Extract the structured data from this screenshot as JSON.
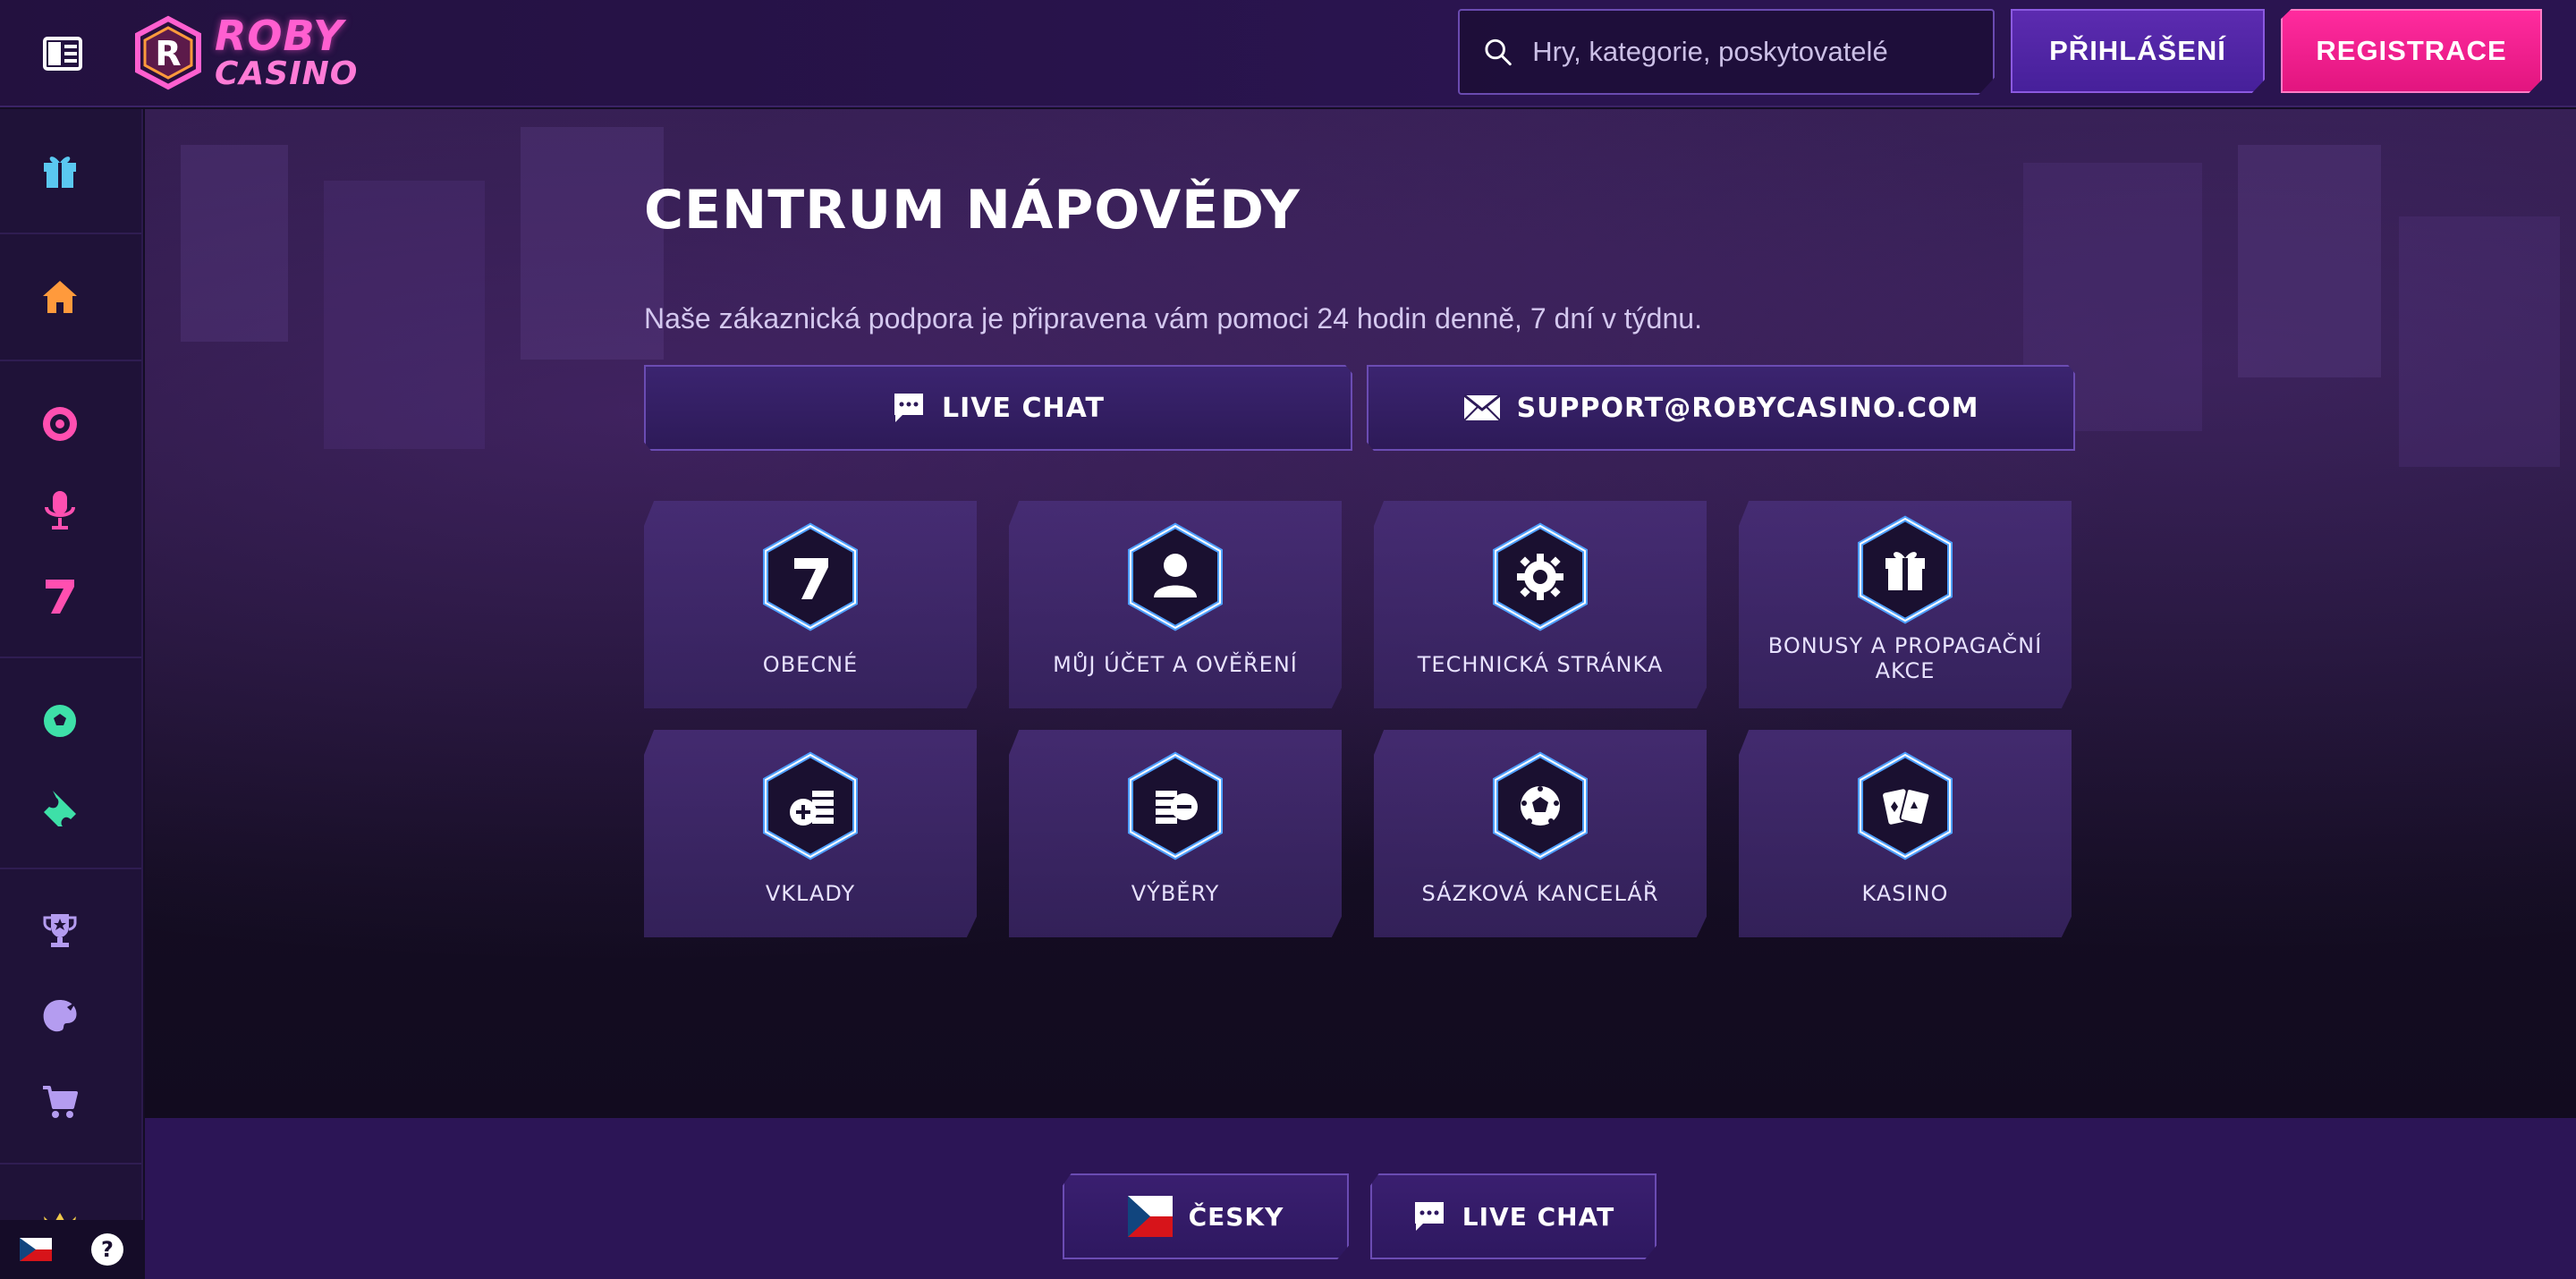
{
  "header": {
    "logo_line1": "ROBY",
    "logo_line2": "CASINO",
    "search_placeholder": "Hry, kategorie, poskytovatelé",
    "login_label": "PŘIHLÁŠENÍ",
    "register_label": "REGISTRACE"
  },
  "sidebar": {
    "items": [
      {
        "name": "gift",
        "color": "#5ac8f0"
      },
      {
        "name": "home",
        "color": "#ff9a3c"
      },
      {
        "name": "live-casino",
        "color": "#ff4fb0"
      },
      {
        "name": "microphone",
        "color": "#ff4fb0"
      },
      {
        "name": "slots-seven",
        "color": "#ff4fb0"
      },
      {
        "name": "sports-ball",
        "color": "#3ee0a8"
      },
      {
        "name": "ticket",
        "color": "#3ee0a8"
      },
      {
        "name": "trophy",
        "color": "#b49cf0"
      },
      {
        "name": "palette",
        "color": "#b49cf0"
      },
      {
        "name": "cart",
        "color": "#b49cf0"
      },
      {
        "name": "crown",
        "color": "#f0c84a"
      }
    ],
    "help_label": "?"
  },
  "main": {
    "title": "CENTRUM NÁPOVĚDY",
    "subtitle": "Naše zákaznická podpora je připravena vám pomoci 24 hodin denně, 7 dní v týdnu.",
    "live_chat_label": "LIVE CHAT",
    "email_label": "SUPPORT@ROBYCASINO.COM",
    "categories": [
      {
        "label": "OBECNÉ",
        "icon": "seven-icon"
      },
      {
        "label": "MŮJ ÚČET A OVĚŘENÍ",
        "icon": "user-icon"
      },
      {
        "label": "TECHNICKÁ STRÁNKA",
        "icon": "gear-icon"
      },
      {
        "label": "BONUSY A PROPAGAČNÍ AKCE",
        "icon": "gift-icon"
      },
      {
        "label": "VKLADY",
        "icon": "deposit-icon"
      },
      {
        "label": "VÝBĚRY",
        "icon": "withdraw-icon"
      },
      {
        "label": "SÁZKOVÁ KANCELÁŘ",
        "icon": "ball-icon"
      },
      {
        "label": "KASINO",
        "icon": "cards-icon"
      }
    ]
  },
  "footer": {
    "language_label": "ČESKY",
    "live_chat_label": "LIVE CHAT"
  },
  "colors": {
    "accent_pink": "#ff2b9e",
    "accent_purple": "#5c2bb0",
    "icon_glow": "#3d8bff"
  }
}
